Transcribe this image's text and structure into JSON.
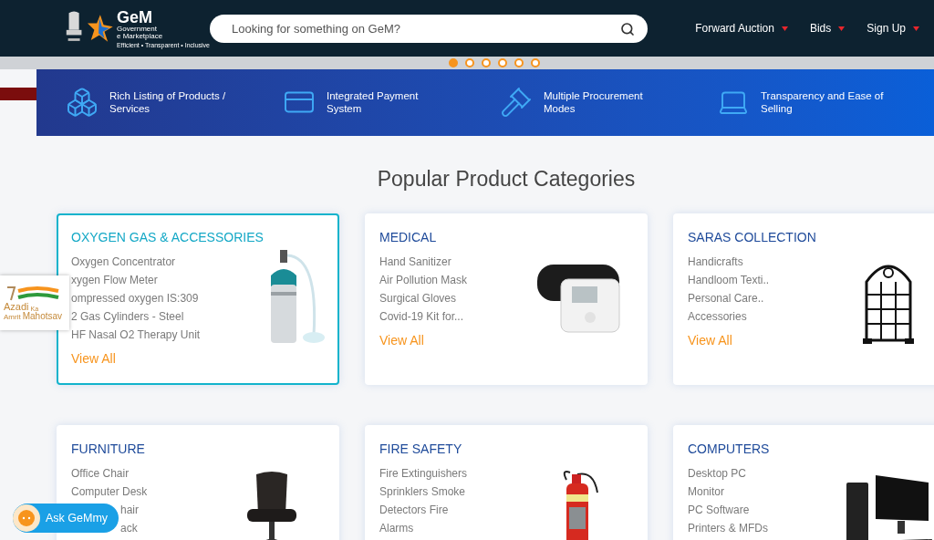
{
  "header": {
    "logo": {
      "name": "GeM",
      "line_1": "Government",
      "line_2": "e Marketplace",
      "tagline": "Efficient • Transparent • Inclusive"
    },
    "search": {
      "placeholder": "Looking for something on GeM?"
    },
    "nav": [
      {
        "label": "Forward Auction"
      },
      {
        "label": "Bids"
      },
      {
        "label": "Sign Up"
      }
    ]
  },
  "carousel": {
    "dots": [
      {
        "selected": true
      },
      {
        "selected": false
      },
      {
        "selected": false
      },
      {
        "selected": false
      },
      {
        "selected": false
      },
      {
        "selected": false
      }
    ]
  },
  "features": [
    {
      "kind": "boxes",
      "label": "Rich Listing of Products / Services"
    },
    {
      "kind": "payment",
      "label": "Integrated Payment System"
    },
    {
      "kind": "gavel",
      "label": "Multiple Procurement Modes"
    },
    {
      "kind": "laptop",
      "label": "Transparency and Ease of Selling"
    }
  ],
  "section_title": "Popular Product Categories",
  "categories": [
    {
      "title": "OXYGEN GAS & ACCESSORIES",
      "selected": true,
      "items": [
        {
          "text": "Oxygen Concentrator",
          "partial": false
        },
        {
          "text": "xygen Flow Meter",
          "partial": false
        },
        {
          "text": "ompressed oxygen IS:309",
          "partial": false
        },
        {
          "text": "2 Gas Cylinders - Steel",
          "partial": false
        },
        {
          "text": "HF Nasal O2 Therapy Unit",
          "partial": false
        }
      ],
      "link": "View All"
    },
    {
      "title": "MEDICAL",
      "selected": false,
      "items": [
        {
          "text": "Hand Sanitizer",
          "partial": false
        },
        {
          "text": "Air Pollution Mask",
          "partial": false
        },
        {
          "text": "Surgical Gloves",
          "partial": false
        },
        {
          "text": "Covid-19 Kit for...",
          "partial": false
        }
      ],
      "link": "View All"
    },
    {
      "title": "SARAS COLLECTION",
      "selected": false,
      "items": [
        {
          "text": "Handicrafts",
          "partial": false
        },
        {
          "text": "Handloom Texti..",
          "partial": false
        },
        {
          "text": "Personal Care..",
          "partial": false
        },
        {
          "text": "Accessories",
          "partial": false
        }
      ],
      "link": "View All"
    },
    {
      "title": "FURNITURE",
      "selected": false,
      "items": [
        {
          "text": "Office Chair",
          "partial": false
        },
        {
          "text": "Computer Desk",
          "partial": false
        },
        {
          "text": "hair",
          "partial": true
        },
        {
          "text": "ack",
          "partial": true
        }
      ]
    },
    {
      "title": "FIRE SAFETY",
      "selected": false,
      "items": [
        {
          "text": "Fire Extinguishers",
          "partial": false
        },
        {
          "text": "Sprinklers Smoke",
          "partial": false
        },
        {
          "text": "Detectors Fire",
          "partial": false
        },
        {
          "text": "Alarms",
          "partial": false
        }
      ]
    },
    {
      "title": "COMPUTERS",
      "selected": false,
      "items": [
        {
          "text": "Desktop PC",
          "partial": false
        },
        {
          "text": "Monitor",
          "partial": false
        },
        {
          "text": "PC Software",
          "partial": false
        },
        {
          "text": "Printers & MFDs",
          "partial": false
        }
      ]
    }
  ],
  "badge": {
    "word_1": "Azadi",
    "word_2": "Ka",
    "word_3": "Amrit",
    "word_4": "Mahotsav"
  },
  "chat_button": {
    "label": "Ask GeMmy"
  }
}
